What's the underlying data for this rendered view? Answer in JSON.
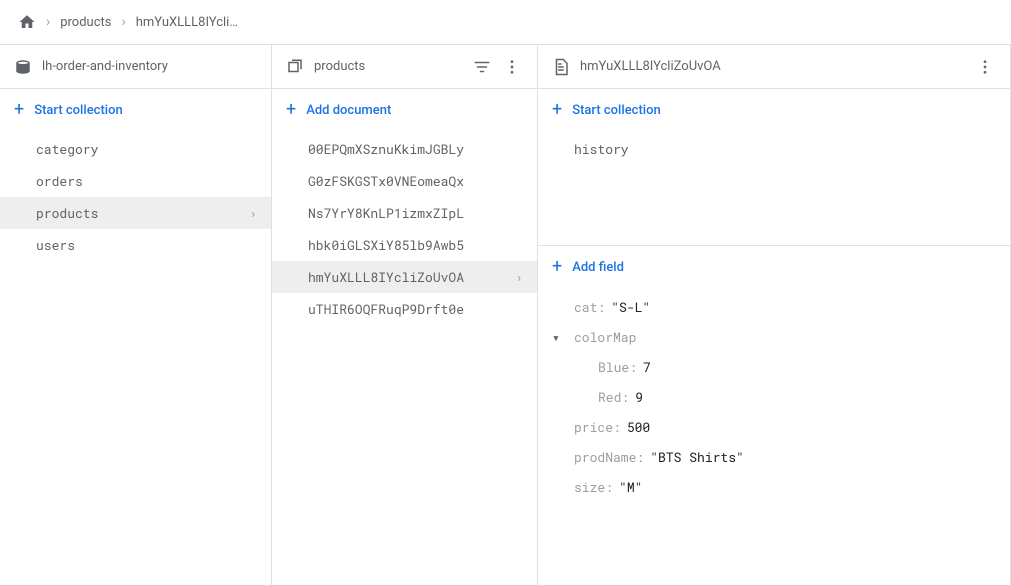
{
  "breadcrumb": {
    "items": [
      "products",
      "hmYuXLLL8IYcli…"
    ]
  },
  "col0": {
    "title": "lh-order-and-inventory",
    "action": "Start collection",
    "items": [
      {
        "label": "category",
        "selected": false
      },
      {
        "label": "orders",
        "selected": false
      },
      {
        "label": "products",
        "selected": true
      },
      {
        "label": "users",
        "selected": false
      }
    ]
  },
  "col1": {
    "title": "products",
    "action": "Add document",
    "items": [
      {
        "label": "00EPQmXSznuKkimJGBLy",
        "selected": false
      },
      {
        "label": "G0zFSKGSTx0VNEomeaQx",
        "selected": false
      },
      {
        "label": "Ns7YrY8KnLP1izmxZIpL",
        "selected": false
      },
      {
        "label": "hbk0iGLSXiY85lb9Awb5",
        "selected": false
      },
      {
        "label": "hmYuXLLL8IYcliZoUvOA",
        "selected": true
      },
      {
        "label": "uTHIR6OQFRuqP9Drft0e",
        "selected": false
      }
    ]
  },
  "col2": {
    "title": "hmYuXLLL8IYcliZoUvOA",
    "startCollection": "Start collection",
    "subcollections": [
      "history"
    ],
    "addField": "Add field",
    "fields": {
      "cat": "\"S-L\"",
      "colorMap": {
        "Blue": "7",
        "Red": "9"
      },
      "price": "500",
      "prodName": "\"BTS Shirts\"",
      "size": "\"M\""
    }
  }
}
